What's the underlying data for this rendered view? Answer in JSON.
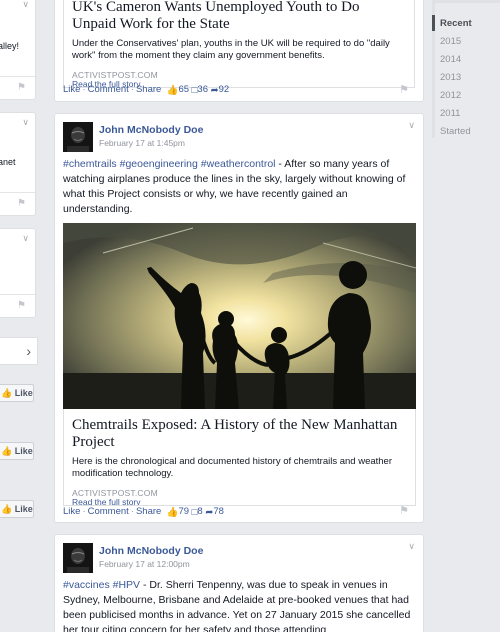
{
  "left_column": {
    "card_a_text": "alley!",
    "card_b_text": "anet",
    "like_label": "Like"
  },
  "post1": {
    "link_title": "UK's Cameron Wants Unemployed Youth to Do Unpaid Work for the State",
    "link_description": "Under the Conservatives' plan, youths in the UK will be required to do \"daily work\" from the moment they claim any government benefits.",
    "link_source": "ACTIVISTPOST.COM",
    "read_more": "Read the full story",
    "actions": {
      "like": "Like",
      "comment": "Comment",
      "share": "Share"
    },
    "counts": {
      "likes": "65",
      "comments": "36",
      "shares": "92"
    }
  },
  "post2": {
    "author": "John McNobody Doe",
    "timestamp": "February 17 at 1:45pm",
    "tags": [
      "#chemtrails",
      "#geoengineering",
      "#weathercontrol"
    ],
    "text": " - After so many years of watching airplanes produce the lines in the sky, largely without knowing of what this Project consists or why, we have recently gained an understanding.",
    "link_title": "Chemtrails Exposed: A History of the New Manhattan Project",
    "link_description": "Here is the chronological and documented history of chemtrails and weather modification technology.",
    "link_source": "ACTIVISTPOST.COM",
    "read_more": "Read the full story",
    "actions": {
      "like": "Like",
      "comment": "Comment",
      "share": "Share"
    },
    "counts": {
      "likes": "79",
      "comments": "8",
      "shares": "78"
    }
  },
  "post3": {
    "author": "John McNobody Doe",
    "timestamp": "February 17 at 12:00pm",
    "tags": [
      "#vaccines",
      "#HPV"
    ],
    "text": " - Dr. Sherri Tenpenny, was due to speak in venues in Sydney, Melbourne, Brisbane and Adelaide at pre-booked venues that had been publicised months in advance. Yet on 27 January 2015 she cancelled her tour citing concern for her safety and those attending"
  },
  "years": {
    "items": [
      "Recent",
      "2015",
      "2014",
      "2013",
      "2012",
      "2011",
      "Started"
    ],
    "active": "Recent"
  },
  "colors": {
    "link": "#3b5998",
    "muted": "#90949c",
    "background": "#e9eaed"
  }
}
